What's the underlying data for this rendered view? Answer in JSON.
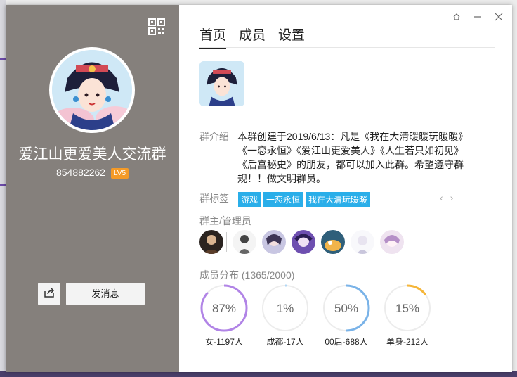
{
  "left_panel": {
    "group_name": "爱江山更爱美人交流群",
    "group_id": "854882262",
    "level": "LV5",
    "send_message_label": "发消息"
  },
  "tabs": [
    {
      "label": "首页",
      "active": true
    },
    {
      "label": "成员",
      "active": false
    },
    {
      "label": "设置",
      "active": false
    }
  ],
  "intro": {
    "label": "群介绍",
    "text": "本群创建于2019/6/13：凡是《我在大清暖暖玩暖暖》《一恋永恒》《爱江山更爱美人》《人生若只如初见》《后宫秘史》的朋友，都可以加入此群。希望遵守群规！！做文明群员。"
  },
  "tags": {
    "label": "群标签",
    "items": [
      "游戏",
      "一恋永恒",
      "我在大清玩暖暖"
    ],
    "prev_icon": "‹",
    "next_icon": "›"
  },
  "admins": {
    "label": "群主/管理员",
    "count": 7
  },
  "distribution": {
    "label": "成员分布",
    "counts": "(1365/2000)",
    "items": [
      {
        "percent": "87%",
        "fraction": 0.87,
        "caption": "女-1197人",
        "color": "#b184e6"
      },
      {
        "percent": "1%",
        "fraction": 0.01,
        "caption": "成都-17人",
        "color": "#b2d7f5"
      },
      {
        "percent": "50%",
        "fraction": 0.5,
        "caption": "00后-688人",
        "color": "#7ab3e8"
      },
      {
        "percent": "15%",
        "fraction": 0.15,
        "caption": "单身-212人",
        "color": "#f5b63a"
      }
    ]
  },
  "colors": {
    "left_bg": "#85807c",
    "tag_bg": "#2aaee9",
    "lv_badge": "#f49a27"
  },
  "icons": {
    "qr": "qr-code-icon",
    "share": "share-icon",
    "home": "pin-icon",
    "minimize": "minimize-icon",
    "close": "close-icon"
  }
}
